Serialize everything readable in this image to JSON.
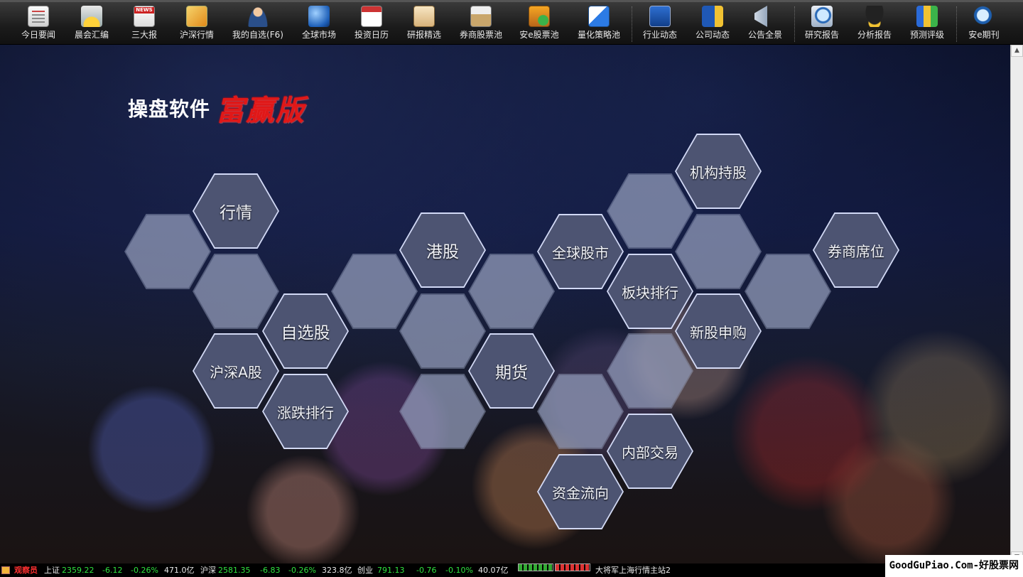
{
  "toolbar": {
    "items": [
      {
        "label": "今日要闻",
        "icon": "newspaper-icon"
      },
      {
        "label": "晨会汇编",
        "icon": "sunrise-icon"
      },
      {
        "label": "三大报",
        "icon": "news-icon"
      },
      {
        "label": "沪深行情",
        "icon": "market-chart-icon"
      },
      {
        "label": "我的自选(F6)",
        "icon": "user-icon"
      },
      {
        "label": "全球市场",
        "icon": "globe-icon"
      },
      {
        "label": "投资日历",
        "icon": "calendar-icon"
      },
      {
        "label": "研报精选",
        "icon": "clipboard-icon"
      },
      {
        "label": "券商股票池",
        "icon": "stock-pool-icon"
      },
      {
        "label": "安e股票池",
        "icon": "e-stock-pool-icon"
      },
      {
        "label": "量化策略池",
        "icon": "strategy-icon"
      },
      {
        "label": "行业动态",
        "icon": "monitor-chart-icon"
      },
      {
        "label": "公司动态",
        "icon": "building-icon"
      },
      {
        "label": "公告全景",
        "icon": "megaphone-icon"
      },
      {
        "label": "研究报告",
        "icon": "magnifier-report-icon"
      },
      {
        "label": "分析报告",
        "icon": "graduation-cap-icon"
      },
      {
        "label": "预测评级",
        "icon": "rating-icon"
      },
      {
        "label": "安e期刊",
        "icon": "magnifier-icon"
      }
    ]
  },
  "logo": {
    "text": "操盘软件",
    "script": "富赢版"
  },
  "hexes": {
    "hangqing": "行情",
    "ganggu": "港股",
    "quanqiu": "全球股市",
    "jigou": "机构持股",
    "quanshang": "券商席位",
    "zixuan": "自选股",
    "bankuai": "板块排行",
    "xingu": "新股申购",
    "husheng": "沪深A股",
    "qihuo": "期货",
    "zhangdie": "涨跌排行",
    "neibu": "内部交易",
    "zijin": "资金流向"
  },
  "status": {
    "role": "观察员",
    "sh_label": "上证",
    "sh_val": "2359.22",
    "sh_chg": "-6.12",
    "sh_pct": "-0.26%",
    "sh_amt": "471.0亿",
    "sz_label": "沪深",
    "sz_val": "2581.35",
    "sz_chg": "-6.83",
    "sz_pct": "-0.26%",
    "sz_amt": "323.8亿",
    "cy_label": "创业",
    "cy_val": "791.13",
    "cy_chg": "-0.76",
    "cy_pct": "-0.10%",
    "cy_amt": "40.07亿",
    "server": "大将军上海行情主站2"
  },
  "watermark": "GoodGuPiao.Com-好股票网",
  "colors": {
    "up": "#ff3030",
    "down": "#2fe33f",
    "logo_red": "#e01818"
  }
}
